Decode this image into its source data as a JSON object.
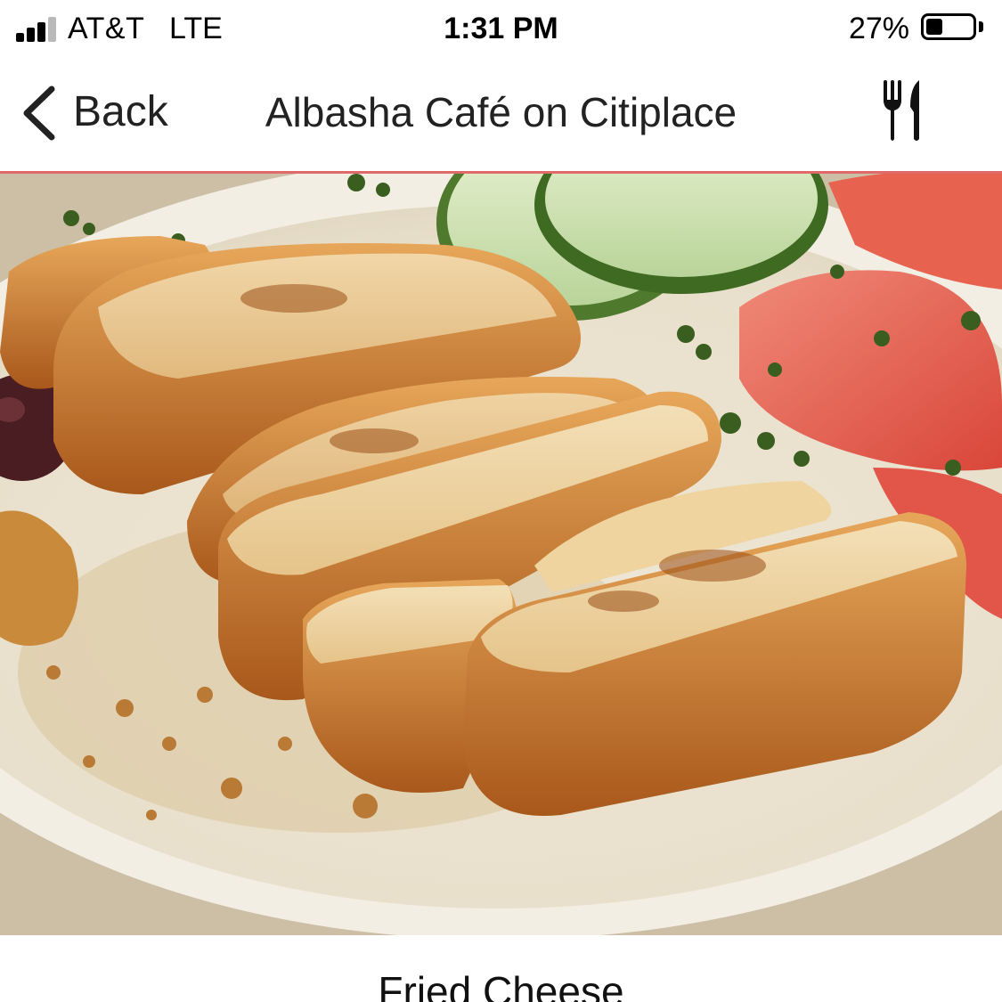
{
  "status_bar": {
    "carrier": "AT&T",
    "network": "LTE",
    "time": "1:31 PM",
    "battery_percent_label": "27%",
    "battery_level": 0.27,
    "signal_bars": 3
  },
  "nav": {
    "back_label": "Back",
    "title": "Albasha Café on Citiplace",
    "back_icon": "chevron-left-icon",
    "menu_icon": "fork-knife-icon"
  },
  "item": {
    "name": "Fried Cheese"
  },
  "colors": {
    "accent_divider": "#e06a6a",
    "text": "#222222"
  }
}
